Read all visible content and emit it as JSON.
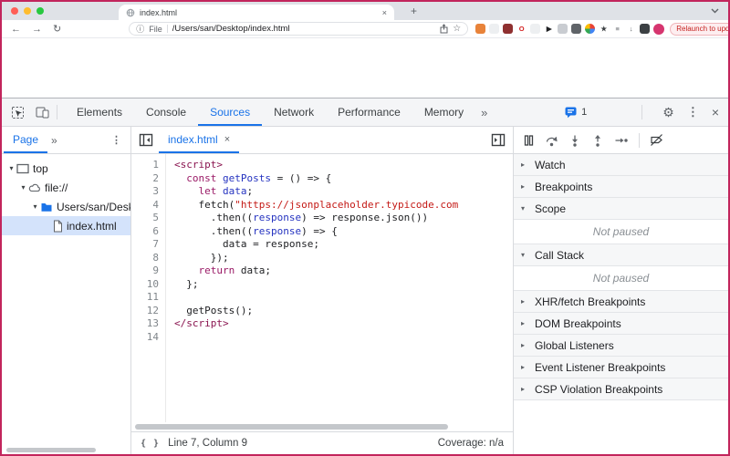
{
  "window": {
    "traffic_lights": [
      "#ff5f57",
      "#febc2e",
      "#28c840"
    ],
    "tab_title": "index.html",
    "tab_close": "×",
    "new_tab": "+",
    "nav": {
      "back": "←",
      "forward": "→",
      "reload": "↻"
    },
    "url_bar": {
      "info": "ⓘ",
      "scheme_chip": "File",
      "path": "/Users/san/Desktop/index.html",
      "star": "☆"
    },
    "extension_icons": [
      {
        "name": "extension-metamask-icon",
        "bg": "#e8833a",
        "glyph": "",
        "fg": ""
      },
      {
        "name": "extension-icon",
        "bg": "#edeff1",
        "glyph": "",
        "fg": ""
      },
      {
        "name": "extension-icon",
        "bg": "#8f3030",
        "glyph": "",
        "fg": ""
      },
      {
        "name": "extension-opera-icon",
        "bg": "#ffffff",
        "glyph": "O",
        "fg": "#d21f1f"
      },
      {
        "name": "extension-icon",
        "bg": "#edeff1",
        "glyph": "",
        "fg": ""
      },
      {
        "name": "extension-arrow-icon",
        "bg": "#ffffff",
        "glyph": "▶",
        "fg": "#202124"
      },
      {
        "name": "extension-icon",
        "bg": "#c9ccd1",
        "glyph": "",
        "fg": ""
      },
      {
        "name": "extension-icon",
        "bg": "#5f6368",
        "glyph": "",
        "fg": ""
      },
      {
        "name": "extension-pinwheel-icon",
        "bg": "pinwheel",
        "glyph": "",
        "fg": ""
      },
      {
        "name": "extension-star-icon",
        "bg": "#ffffff",
        "glyph": "★",
        "fg": "#3c4043"
      },
      {
        "name": "reading-list-icon",
        "bg": "#ffffff",
        "glyph": "≡",
        "fg": "#5f6368"
      },
      {
        "name": "download-icon",
        "bg": "#ffffff",
        "glyph": "↓",
        "fg": "#5f6368"
      },
      {
        "name": "extension-icon",
        "bg": "#3c4043",
        "glyph": "",
        "fg": ""
      }
    ],
    "relaunch_button": "Relaunch to update",
    "relaunch_kebab": "⋮"
  },
  "devtools": {
    "main_tabs": [
      {
        "label": "Elements",
        "active": false
      },
      {
        "label": "Console",
        "active": false
      },
      {
        "label": "Sources",
        "active": true
      },
      {
        "label": "Network",
        "active": false
      },
      {
        "label": "Performance",
        "active": false
      },
      {
        "label": "Memory",
        "active": false
      }
    ],
    "more_tabs": "»",
    "issues_count": "1",
    "gear": "⚙",
    "kebab": "⋮",
    "close": "×",
    "navigator": {
      "tab_label": "Page",
      "more": "»",
      "kebab": "⋮",
      "tree": [
        {
          "label": "top",
          "icon": "frame-icon",
          "depth": 0,
          "expanded": true,
          "selected": false
        },
        {
          "label": "file://",
          "icon": "cloud-icon",
          "depth": 1,
          "expanded": true,
          "selected": false
        },
        {
          "label": "Users/san/Desktop",
          "icon": "folder-icon",
          "depth": 2,
          "expanded": true,
          "selected": false
        },
        {
          "label": "index.html",
          "icon": "file-icon",
          "depth": 3,
          "expanded": null,
          "selected": true
        }
      ]
    },
    "editor": {
      "file_tab": "index.html",
      "tab_close": "×",
      "code_lines": [
        [
          [
            "<script>",
            "tag"
          ]
        ],
        [
          [
            "  ",
            "pl"
          ],
          [
            "const",
            "kw"
          ],
          [
            " ",
            "pl"
          ],
          [
            "getPosts",
            "def"
          ],
          [
            " = () => {",
            "pl"
          ]
        ],
        [
          [
            "    ",
            "pl"
          ],
          [
            "let",
            "kw"
          ],
          [
            " ",
            "pl"
          ],
          [
            "data",
            "def"
          ],
          [
            ";",
            "pl"
          ]
        ],
        [
          [
            "    fetch(",
            "pl"
          ],
          [
            "\"https://jsonplaceholder.typicode.com",
            "str"
          ]
        ],
        [
          [
            "      .then((",
            "pl"
          ],
          [
            "response",
            "def"
          ],
          [
            ") => response.json())",
            "pl"
          ]
        ],
        [
          [
            "      .then((",
            "pl"
          ],
          [
            "response",
            "def"
          ],
          [
            ") => {",
            "pl"
          ]
        ],
        [
          [
            "        data = response;",
            "pl"
          ]
        ],
        [
          [
            "      });",
            "pl"
          ]
        ],
        [
          [
            "    ",
            "pl"
          ],
          [
            "return",
            "kw"
          ],
          [
            " data;",
            "pl"
          ]
        ],
        [
          [
            "  };",
            "pl"
          ]
        ],
        [],
        [
          [
            "  getPosts();",
            "pl"
          ]
        ],
        [
          [
            "</script>",
            "tag"
          ]
        ],
        []
      ],
      "status": {
        "format_icon": "{ }",
        "cursor": "Line 7, Column 9",
        "coverage": "Coverage: n/a"
      }
    },
    "debugger": {
      "sections": [
        {
          "label": "Watch",
          "expanded": false,
          "content": null
        },
        {
          "label": "Breakpoints",
          "expanded": false,
          "content": null
        },
        {
          "label": "Scope",
          "expanded": true,
          "content": "Not paused"
        },
        {
          "label": "Call Stack",
          "expanded": true,
          "content": "Not paused"
        },
        {
          "label": "XHR/fetch Breakpoints",
          "expanded": false,
          "content": null
        },
        {
          "label": "DOM Breakpoints",
          "expanded": false,
          "content": null
        },
        {
          "label": "Global Listeners",
          "expanded": false,
          "content": null
        },
        {
          "label": "Event Listener Breakpoints",
          "expanded": false,
          "content": null
        },
        {
          "label": "CSP Violation Breakpoints",
          "expanded": false,
          "content": null
        }
      ]
    }
  },
  "colors": {
    "accent": "#1a73e8",
    "frame_border": "#c2255c",
    "token_tag": "#8a1550",
    "token_keyword": "#9a1a66",
    "token_string": "#c41a16",
    "token_definition": "#2533c0"
  }
}
